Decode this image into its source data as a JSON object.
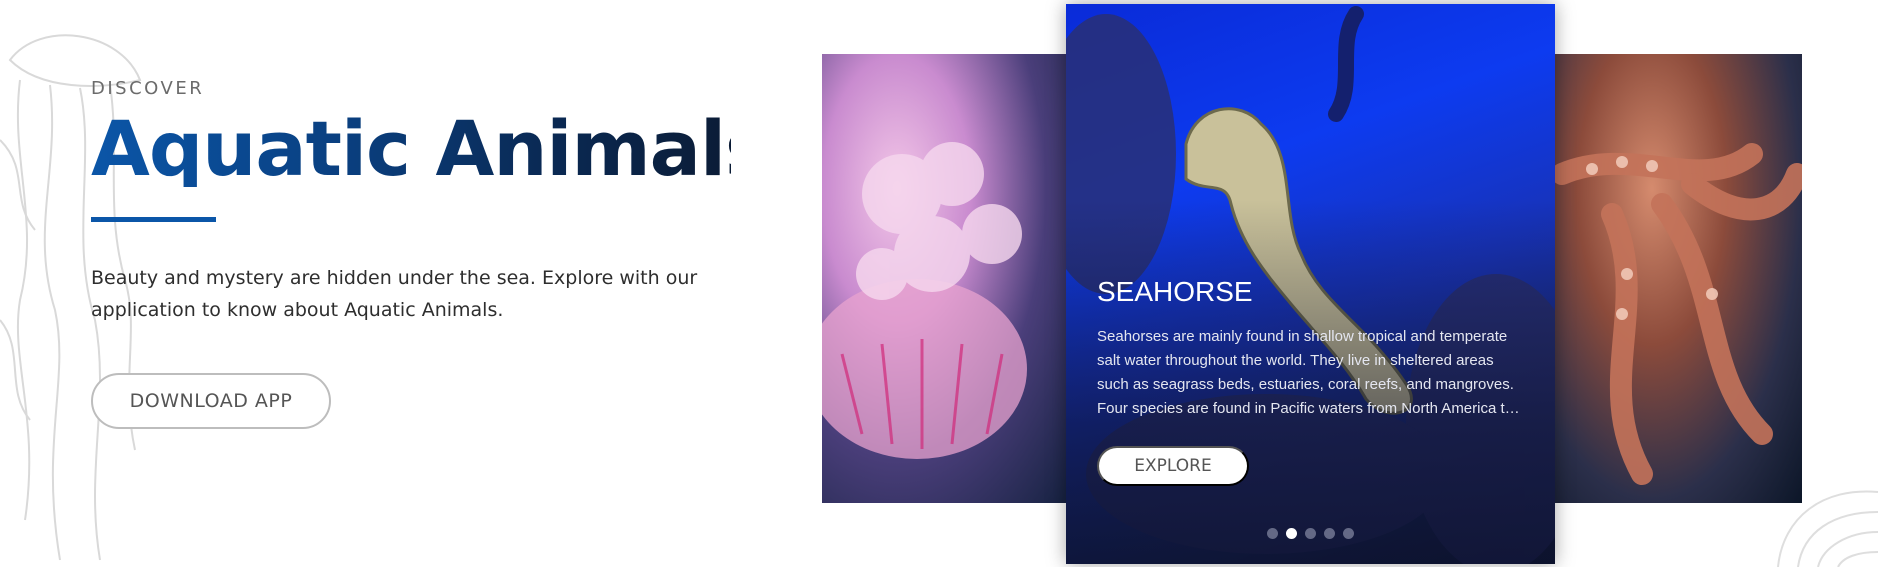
{
  "hero": {
    "eyebrow": "DISCOVER",
    "title": "Aquatic Animals",
    "description": "Beauty and mystery are hidden under the sea. Explore with our application to know about Aquatic Animals.",
    "download_label": "DOWNLOAD APP"
  },
  "carousel": {
    "slides": [
      {
        "name": "jellyfish"
      },
      {
        "title": "SEAHORSE",
        "description": "Seahorses are mainly found in shallow tropical and temperate salt water throughout the world. They live in sheltered areas such as seagrass beds, estuaries, coral reefs, and mangroves. Four species are found in Pacific waters from North America to South America.",
        "explore_label": "EXPLORE"
      },
      {
        "name": "octopus"
      }
    ],
    "dot_count": 5,
    "active_dot": 2
  },
  "colors": {
    "accent": "#0b56a8",
    "title_dark": "#0b1c36"
  },
  "icons": [
    "jellyfish-lineart-icon",
    "shell-lineart-icon"
  ]
}
